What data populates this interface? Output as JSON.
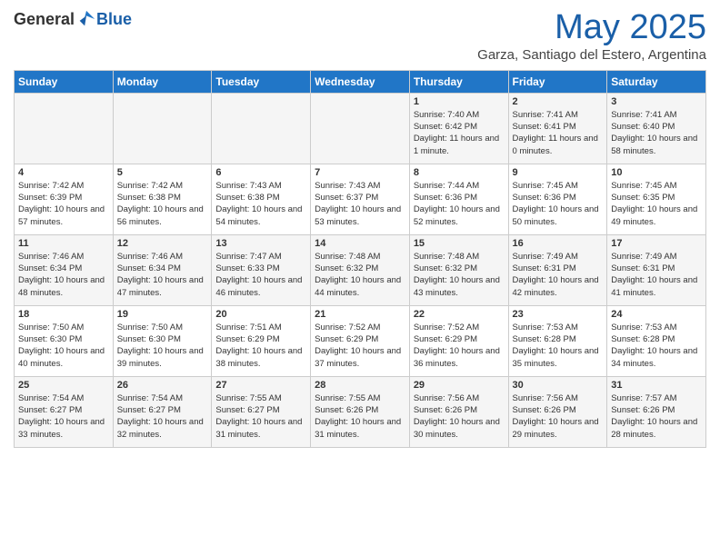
{
  "header": {
    "logo_general": "General",
    "logo_blue": "Blue",
    "month": "May 2025",
    "location": "Garza, Santiago del Estero, Argentina"
  },
  "days_of_week": [
    "Sunday",
    "Monday",
    "Tuesday",
    "Wednesday",
    "Thursday",
    "Friday",
    "Saturday"
  ],
  "weeks": [
    [
      {
        "day": "",
        "info": ""
      },
      {
        "day": "",
        "info": ""
      },
      {
        "day": "",
        "info": ""
      },
      {
        "day": "",
        "info": ""
      },
      {
        "day": "1",
        "info": "Sunrise: 7:40 AM\nSunset: 6:42 PM\nDaylight: 11 hours and 1 minute."
      },
      {
        "day": "2",
        "info": "Sunrise: 7:41 AM\nSunset: 6:41 PM\nDaylight: 11 hours and 0 minutes."
      },
      {
        "day": "3",
        "info": "Sunrise: 7:41 AM\nSunset: 6:40 PM\nDaylight: 10 hours and 58 minutes."
      }
    ],
    [
      {
        "day": "4",
        "info": "Sunrise: 7:42 AM\nSunset: 6:39 PM\nDaylight: 10 hours and 57 minutes."
      },
      {
        "day": "5",
        "info": "Sunrise: 7:42 AM\nSunset: 6:38 PM\nDaylight: 10 hours and 56 minutes."
      },
      {
        "day": "6",
        "info": "Sunrise: 7:43 AM\nSunset: 6:38 PM\nDaylight: 10 hours and 54 minutes."
      },
      {
        "day": "7",
        "info": "Sunrise: 7:43 AM\nSunset: 6:37 PM\nDaylight: 10 hours and 53 minutes."
      },
      {
        "day": "8",
        "info": "Sunrise: 7:44 AM\nSunset: 6:36 PM\nDaylight: 10 hours and 52 minutes."
      },
      {
        "day": "9",
        "info": "Sunrise: 7:45 AM\nSunset: 6:36 PM\nDaylight: 10 hours and 50 minutes."
      },
      {
        "day": "10",
        "info": "Sunrise: 7:45 AM\nSunset: 6:35 PM\nDaylight: 10 hours and 49 minutes."
      }
    ],
    [
      {
        "day": "11",
        "info": "Sunrise: 7:46 AM\nSunset: 6:34 PM\nDaylight: 10 hours and 48 minutes."
      },
      {
        "day": "12",
        "info": "Sunrise: 7:46 AM\nSunset: 6:34 PM\nDaylight: 10 hours and 47 minutes."
      },
      {
        "day": "13",
        "info": "Sunrise: 7:47 AM\nSunset: 6:33 PM\nDaylight: 10 hours and 46 minutes."
      },
      {
        "day": "14",
        "info": "Sunrise: 7:48 AM\nSunset: 6:32 PM\nDaylight: 10 hours and 44 minutes."
      },
      {
        "day": "15",
        "info": "Sunrise: 7:48 AM\nSunset: 6:32 PM\nDaylight: 10 hours and 43 minutes."
      },
      {
        "day": "16",
        "info": "Sunrise: 7:49 AM\nSunset: 6:31 PM\nDaylight: 10 hours and 42 minutes."
      },
      {
        "day": "17",
        "info": "Sunrise: 7:49 AM\nSunset: 6:31 PM\nDaylight: 10 hours and 41 minutes."
      }
    ],
    [
      {
        "day": "18",
        "info": "Sunrise: 7:50 AM\nSunset: 6:30 PM\nDaylight: 10 hours and 40 minutes."
      },
      {
        "day": "19",
        "info": "Sunrise: 7:50 AM\nSunset: 6:30 PM\nDaylight: 10 hours and 39 minutes."
      },
      {
        "day": "20",
        "info": "Sunrise: 7:51 AM\nSunset: 6:29 PM\nDaylight: 10 hours and 38 minutes."
      },
      {
        "day": "21",
        "info": "Sunrise: 7:52 AM\nSunset: 6:29 PM\nDaylight: 10 hours and 37 minutes."
      },
      {
        "day": "22",
        "info": "Sunrise: 7:52 AM\nSunset: 6:29 PM\nDaylight: 10 hours and 36 minutes."
      },
      {
        "day": "23",
        "info": "Sunrise: 7:53 AM\nSunset: 6:28 PM\nDaylight: 10 hours and 35 minutes."
      },
      {
        "day": "24",
        "info": "Sunrise: 7:53 AM\nSunset: 6:28 PM\nDaylight: 10 hours and 34 minutes."
      }
    ],
    [
      {
        "day": "25",
        "info": "Sunrise: 7:54 AM\nSunset: 6:27 PM\nDaylight: 10 hours and 33 minutes."
      },
      {
        "day": "26",
        "info": "Sunrise: 7:54 AM\nSunset: 6:27 PM\nDaylight: 10 hours and 32 minutes."
      },
      {
        "day": "27",
        "info": "Sunrise: 7:55 AM\nSunset: 6:27 PM\nDaylight: 10 hours and 31 minutes."
      },
      {
        "day": "28",
        "info": "Sunrise: 7:55 AM\nSunset: 6:26 PM\nDaylight: 10 hours and 31 minutes."
      },
      {
        "day": "29",
        "info": "Sunrise: 7:56 AM\nSunset: 6:26 PM\nDaylight: 10 hours and 30 minutes."
      },
      {
        "day": "30",
        "info": "Sunrise: 7:56 AM\nSunset: 6:26 PM\nDaylight: 10 hours and 29 minutes."
      },
      {
        "day": "31",
        "info": "Sunrise: 7:57 AM\nSunset: 6:26 PM\nDaylight: 10 hours and 28 minutes."
      }
    ]
  ]
}
